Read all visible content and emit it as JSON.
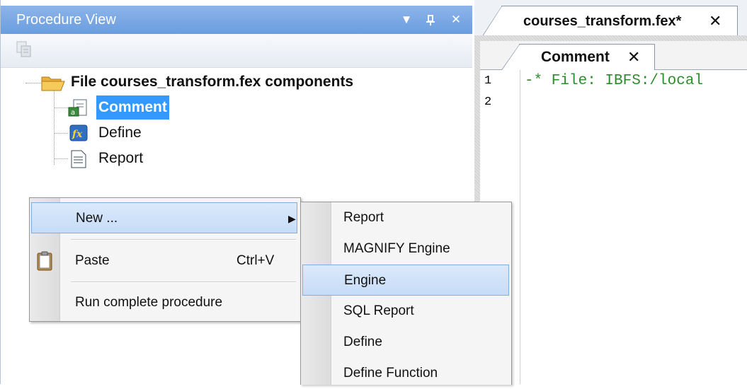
{
  "procedure_view": {
    "title": "Procedure View",
    "controls": {
      "dropdown": "▼",
      "pin": "ꟷ",
      "close": "✕"
    },
    "tree": {
      "root": "File courses_transform.fex components",
      "children": [
        "Comment",
        "Define",
        "Report"
      ],
      "selected": "Comment"
    }
  },
  "editor": {
    "outer_tab": {
      "label": "courses_transform.fex*",
      "close": "✕"
    },
    "inner_tab": {
      "label": "Comment",
      "close": "✕"
    },
    "line_numbers": [
      "1",
      "2"
    ],
    "code_lines": [
      "-* File: IBFS:/local"
    ]
  },
  "context_menu": {
    "items": [
      {
        "label": "New ...",
        "submenu_arrow": "▶",
        "highlighted": true
      },
      {
        "label": "Paste",
        "shortcut": "Ctrl+V",
        "icon": "clipboard-icon"
      },
      {
        "label": "Run complete procedure"
      }
    ]
  },
  "submenu": {
    "items": [
      "Report",
      "MAGNIFY Engine",
      "Engine",
      "SQL Report",
      "Define",
      "Define Function"
    ],
    "highlighted": "Engine"
  },
  "colors": {
    "title_bar": "#7aa8e6",
    "selection": "#3399ff",
    "menu_highlight": "#c6dcf7",
    "code_comment": "#2e8b2e"
  }
}
